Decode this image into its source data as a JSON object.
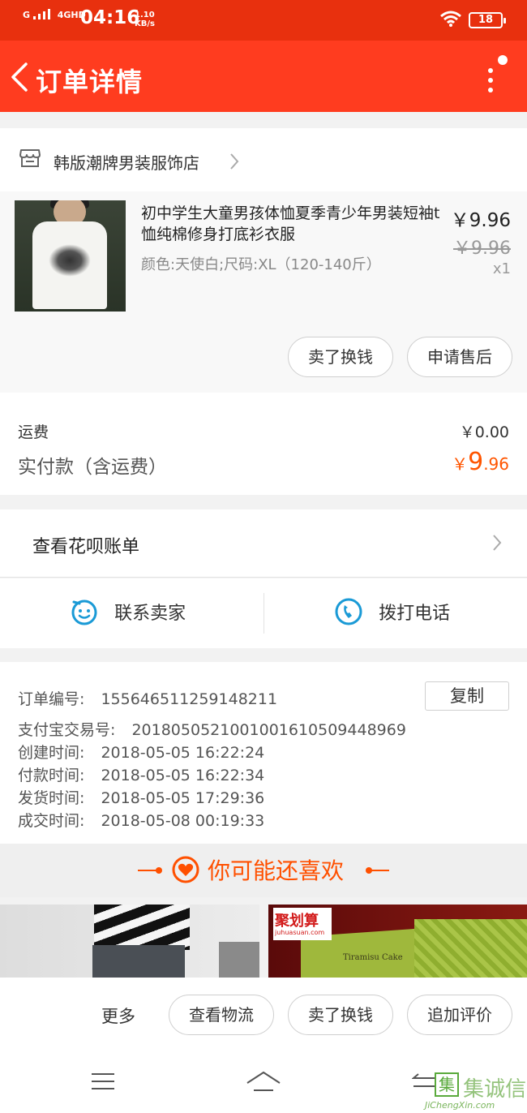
{
  "status_bar": {
    "signal1": "G",
    "signal2": "4GHD",
    "time": "04:16",
    "speed_value": "1.10",
    "speed_unit": "KB/s",
    "battery": "18"
  },
  "title_bar": {
    "title": "订单详情",
    "back_icon": "chevron-left-icon",
    "more_icon": "vertical-dots-icon"
  },
  "shop": {
    "name": "韩版潮牌男装服饰店",
    "icon": "store-icon"
  },
  "product": {
    "title": "初中学生大童男孩体恤夏季青少年男装短袖t恤纯棉修身打底衫衣服",
    "spec": "颜色:天使白;尺码:XL（120-140斤）",
    "price": "￥9.96",
    "original_price": "￥9.96",
    "quantity": "x1",
    "buttons": [
      "卖了换钱",
      "申请售后"
    ]
  },
  "fees": {
    "shipping_label": "运费",
    "shipping_value": "￥0.00",
    "paid_label": "实付款（含运费）",
    "paid_currency": "￥",
    "paid_int": "9",
    "paid_dec": ".96"
  },
  "huabei": {
    "label": "查看花呗账单"
  },
  "contact": {
    "seller_label": "联系卖家",
    "phone_label": "拨打电话",
    "accent": "#1a9ad6"
  },
  "order_info": {
    "order_no_label": "订单编号:",
    "order_no": "155646511259148211",
    "copy_label": "复制",
    "alipay_label": "支付宝交易号:",
    "alipay_no": "2018050521001001610509448969",
    "created_label": "创建时间:",
    "created": "2018-05-05 16:22:24",
    "paid_label": "付款时间:",
    "paid": "2018-05-05 16:22:34",
    "shipped_label": "发货时间:",
    "shipped": "2018-05-05 17:29:36",
    "closed_label": "成交时间:",
    "closed": "2018-05-08 00:19:33"
  },
  "recommend": {
    "title": "你可能还喜欢",
    "brand_label": "聚划算",
    "brand_url": "juhuasuan.com",
    "box_text": "Tiramisu Cake",
    "accent": "#ff5000"
  },
  "action_bar": {
    "more": "更多",
    "buttons": [
      "查看物流",
      "卖了换钱",
      "追加评价"
    ]
  },
  "watermark": {
    "text": "集诚信",
    "url": "JiChengXin.com"
  },
  "colors": {
    "brand_red": "#ff3c1f",
    "status_red": "#e8300e",
    "price_orange": "#ff5500"
  }
}
